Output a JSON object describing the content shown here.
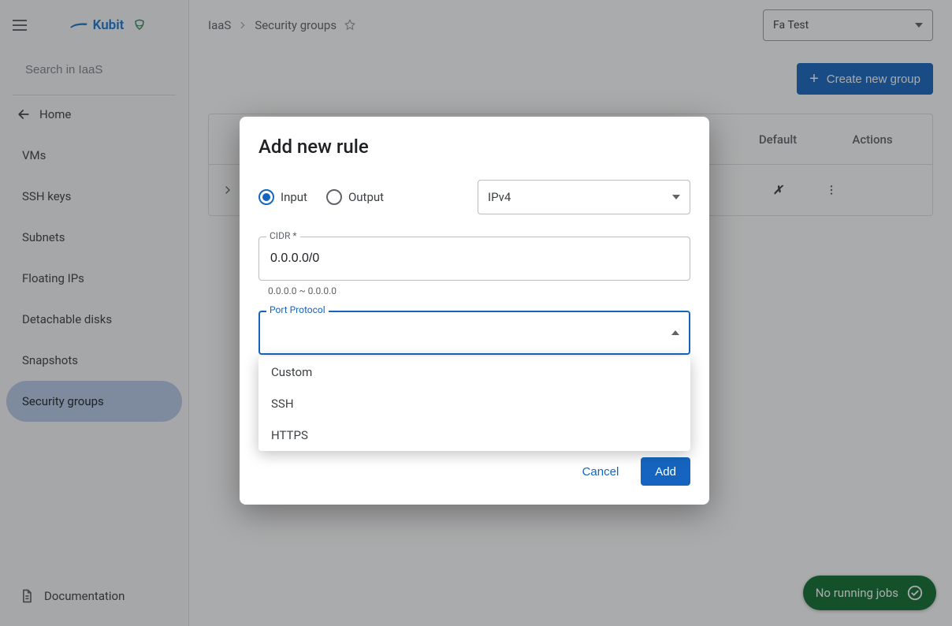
{
  "sidebar": {
    "logo_text": "Kubit",
    "search_placeholder": "Search in IaaS",
    "home_label": "Home",
    "items": [
      {
        "label": "VMs"
      },
      {
        "label": "SSH keys"
      },
      {
        "label": "Subnets"
      },
      {
        "label": "Floating IPs"
      },
      {
        "label": "Detachable disks"
      },
      {
        "label": "Snapshots"
      },
      {
        "label": "Security groups"
      }
    ],
    "active_index": 6,
    "documentation_label": "Documentation"
  },
  "breadcrumb": {
    "root": "IaaS",
    "current": "Security groups"
  },
  "tenant_select": {
    "value": "Fa Test"
  },
  "create_button_label": "Create new group",
  "table": {
    "headers": {
      "default": "Default",
      "actions": "Actions"
    },
    "row": {
      "default_mark": "✗"
    }
  },
  "jobs_pill": "No running jobs",
  "dialog": {
    "title": "Add new rule",
    "radio_input": "Input",
    "radio_output": "Output",
    "radio_selected": "Input",
    "ip_version": "IPv4",
    "cidr_label": "CIDR *",
    "cidr_value": "0.0.0.0/0",
    "cidr_helper": "0.0.0.0 ~ 0.0.0.0",
    "port_protocol_label": "Port Protocol",
    "port_protocol_value": "",
    "dropdown": [
      "Custom",
      "SSH",
      "HTTPS"
    ],
    "cancel": "Cancel",
    "add": "Add"
  }
}
